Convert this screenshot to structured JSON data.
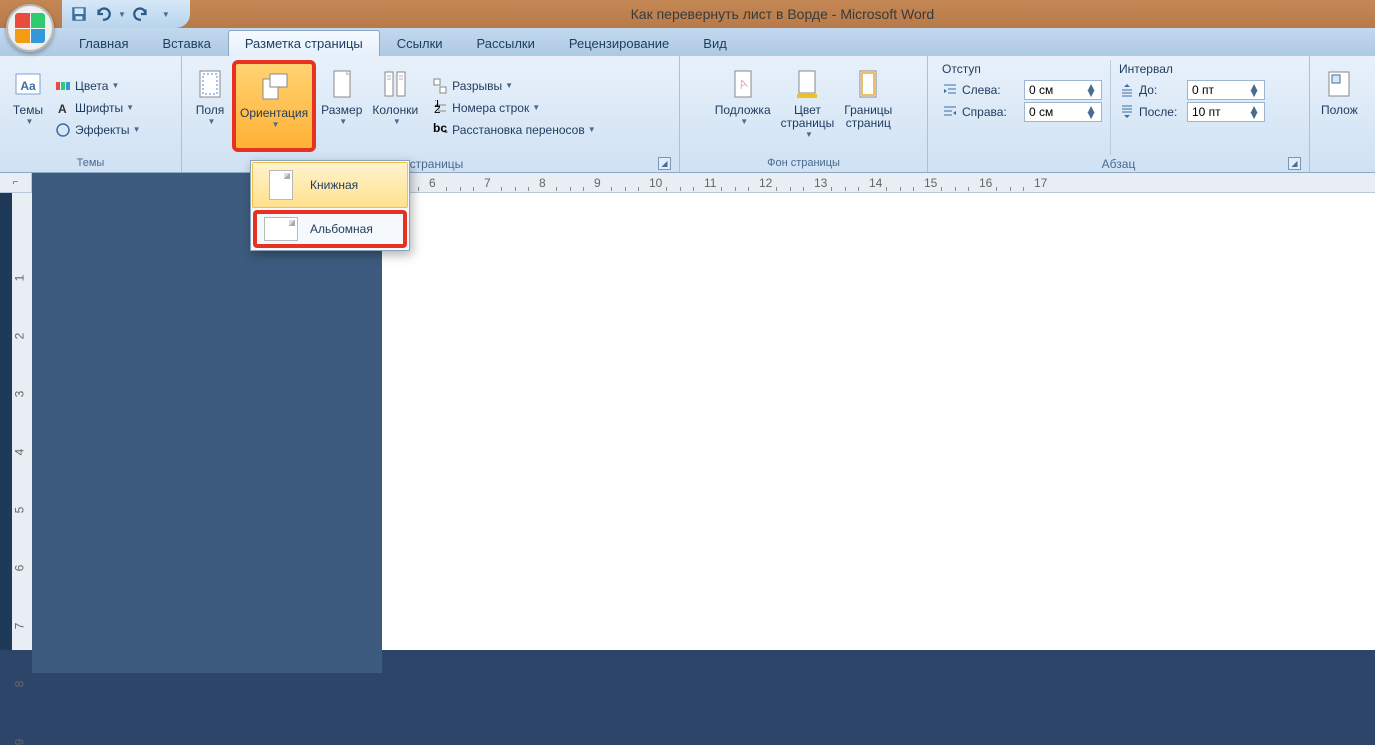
{
  "title": "Как перевернуть лист в Ворде - Microsoft Word",
  "tabs": {
    "t0": "Главная",
    "t1": "Вставка",
    "t2": "Разметка страницы",
    "t3": "Ссылки",
    "t4": "Рассылки",
    "t5": "Рецензирование",
    "t6": "Вид"
  },
  "ribbon": {
    "themes": {
      "label": "Темы",
      "btn": "Темы",
      "colors": "Цвета",
      "fonts": "Шрифты",
      "effects": "Эффекты"
    },
    "page_setup": {
      "label": "ы страницы",
      "margins": "Поля",
      "orientation": "Ориентация",
      "size": "Размер",
      "columns": "Колонки",
      "breaks": "Разрывы",
      "line_numbers": "Номера строк",
      "hyphenation": "Расстановка переносов"
    },
    "orientation_menu": {
      "portrait": "Книжная",
      "landscape": "Альбомная"
    },
    "bg": {
      "label": "Фон страницы",
      "watermark": "Подложка",
      "page_color": "Цвет\nстраницы",
      "borders": "Границы\nстраниц"
    },
    "paragraph": {
      "label": "Абзац",
      "indent_title": "Отступ",
      "left": "Слева:",
      "right": "Справа:",
      "left_val": "0 см",
      "right_val": "0 см",
      "spacing_title": "Интервал",
      "before": "До:",
      "after": "После:",
      "before_val": "0 пт",
      "after_val": "10 пт"
    },
    "arrange": {
      "position": "Полож"
    }
  }
}
